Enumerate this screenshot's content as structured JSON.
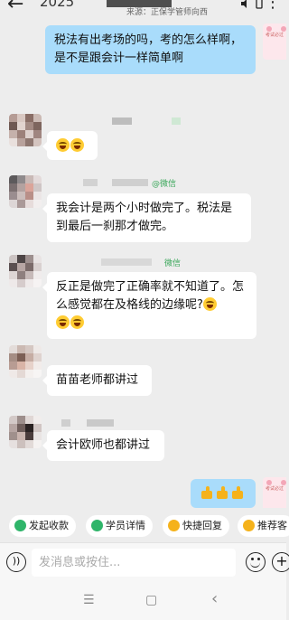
{
  "header": {
    "year_partial": "2025",
    "subtitle": "来源：正保学管师向西",
    "more_icon": "more-icon"
  },
  "messages": [
    {
      "side": "self",
      "text": "税法有出考场的吗，考的怎么样啊，是不是跟会计一样简单啊"
    },
    {
      "side": "other",
      "text": ""
    },
    {
      "side": "other",
      "wechat_tag": "@微信",
      "text": "我会计是两个小时做完了。税法是到最后一刹那才做完。"
    },
    {
      "side": "other",
      "wechat_tag": "微信",
      "text": "反正是做完了正确率就不知道了。怎么感觉都在及格线的边缘呢?"
    },
    {
      "side": "other",
      "text": "苗苗老师都讲过"
    },
    {
      "side": "other",
      "text": "会计欧师也都讲过"
    },
    {
      "side": "self",
      "text": ""
    }
  ],
  "quick_actions": [
    {
      "label": "发起收款",
      "icon": "payment-icon",
      "color": "#2fb56a"
    },
    {
      "label": "学员详情",
      "icon": "student-icon",
      "color": "#2fb56a"
    },
    {
      "label": "快捷回复",
      "icon": "quick-reply-icon",
      "color": "#f5b21b"
    },
    {
      "label": "推荐客",
      "icon": "recommend-icon",
      "color": "#f5b21b"
    }
  ],
  "input": {
    "placeholder": "发消息或按住..."
  },
  "nav": {
    "menu": "☰",
    "home": "▢",
    "back": "‹"
  }
}
